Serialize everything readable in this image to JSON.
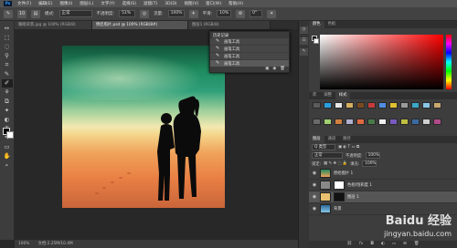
{
  "menubar": {
    "logo": "Ps",
    "items": [
      "文件(F)",
      "编辑(E)",
      "图像(I)",
      "图层(L)",
      "文字(Y)",
      "选择(S)",
      "滤镜(T)",
      "3D(D)",
      "视图(V)",
      "窗口(W)",
      "帮助(H)"
    ]
  },
  "options": {
    "brush_size": "10",
    "mode_label": "模式:",
    "mode_value": "正常",
    "opacity_label": "不透明度:",
    "opacity_value": "51%",
    "flow_label": "流量:",
    "flow_value": "100%",
    "smooth_label": "平滑:",
    "smooth_value": "10%",
    "angle_value": "0°"
  },
  "tabs": [
    {
      "label": "睡眠背景.jpg @ 100% (RGB/8)"
    },
    {
      "label": "情侣照片.psd @ 100% (RGB/8#)"
    },
    {
      "label": "图层1 (RGB/8)"
    }
  ],
  "tools": [
    "↔",
    "⬚",
    "◌",
    "⚲",
    "⌗",
    "✎",
    "✐",
    "⚘",
    "⧉",
    "✦",
    "◐",
    "T",
    "↖",
    "▭",
    "✋",
    "⌕"
  ],
  "history": {
    "title": "历史记录",
    "items": [
      "画笔工具",
      "画笔工具",
      "画笔工具",
      "画笔工具"
    ]
  },
  "status": {
    "zoom": "100%",
    "doc": "文档:2.25M/10.4M"
  },
  "panels": {
    "color_tabs": [
      "颜色",
      "色板"
    ],
    "swatch_tabs": [
      "库",
      "调整",
      "样式"
    ],
    "layer_tabs": [
      "图层",
      "通道",
      "路径"
    ],
    "kind_label": "Q 类型",
    "blend_mode": "正常",
    "opacity_label": "不透明度:",
    "opacity_value": "100%",
    "lock_label": "锁定:",
    "fill_label": "填充:",
    "fill_value": "100%"
  },
  "layers": [
    {
      "name": "原始图片 1"
    },
    {
      "name": "色相/饱和度 1"
    },
    {
      "name": "图层 1"
    },
    {
      "name": "背景"
    }
  ],
  "watermark": {
    "text": "Baidu 经验",
    "url": "jingyan.baidu.com"
  },
  "colors": {
    "accent": "#31a8ff",
    "fg": "#000000",
    "bg": "#ffffff"
  }
}
